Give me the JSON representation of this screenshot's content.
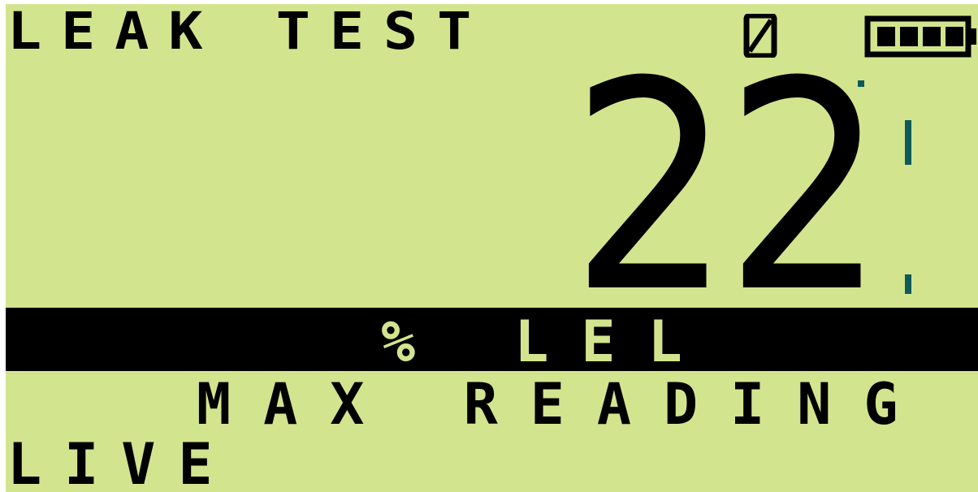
{
  "header": {
    "title": "LEAK TEST",
    "status_icon": "null-zero-icon",
    "battery_icon": "battery-full-icon",
    "battery_level": 1.0
  },
  "reading": {
    "value": "22"
  },
  "unit_bar": {
    "label": "% LEL"
  },
  "mode": {
    "label": "MAX READING"
  },
  "footer": {
    "label": "LIVE"
  },
  "colors": {
    "lcd_background": "#d3e48f",
    "lcd_foreground": "#000000",
    "accent": "#0d5a58"
  }
}
